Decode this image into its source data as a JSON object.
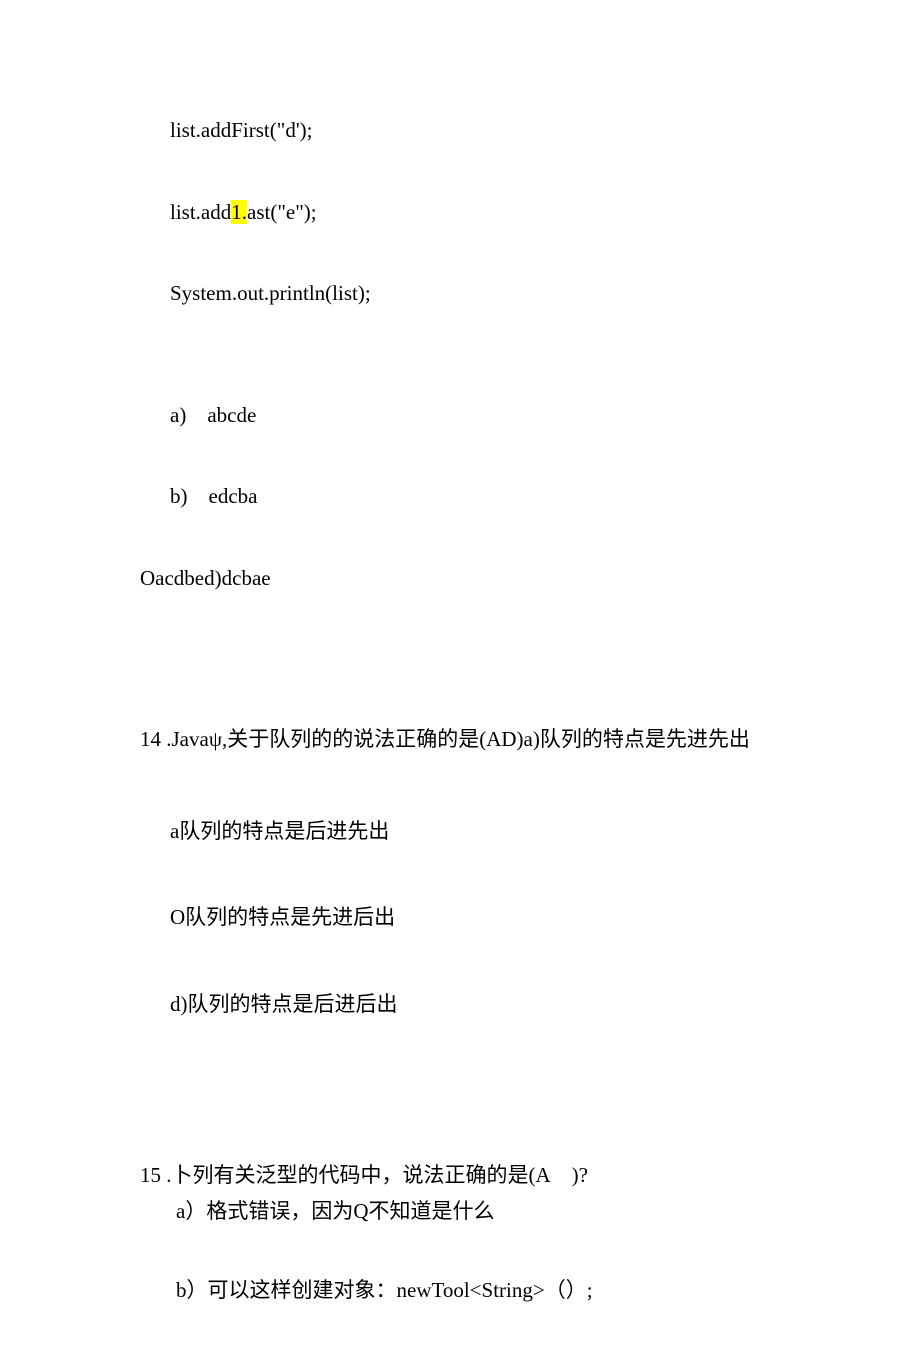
{
  "code": {
    "line1": "list.addFirst(\"d');",
    "line2_pre": "list.add",
    "line2_hl": "1.",
    "line2_post": "ast(\"e\");",
    "line3": "System.out.println(list);"
  },
  "q13_options": {
    "a": "a) abcde",
    "b": "b) edcba",
    "cd": "Oacdbed)dcbae"
  },
  "q14": {
    "header": "14 .Javaψ,关于队列的的说法正确的是(AD)a)队列的特点是先进先出",
    "opt_a": "a队列的特点是后进先出",
    "opt_c": "O队列的特点是先进后出",
    "opt_d": "d)队列的特点是后进后出"
  },
  "q15": {
    "header": "15 .卜列有关泛型的代码中，说法正确的是(A )?",
    "opt_a": "a）格式错误，因为Q不知道是什么",
    "opt_b": "b）可以这样创建对象：newTool<String>（）;"
  }
}
